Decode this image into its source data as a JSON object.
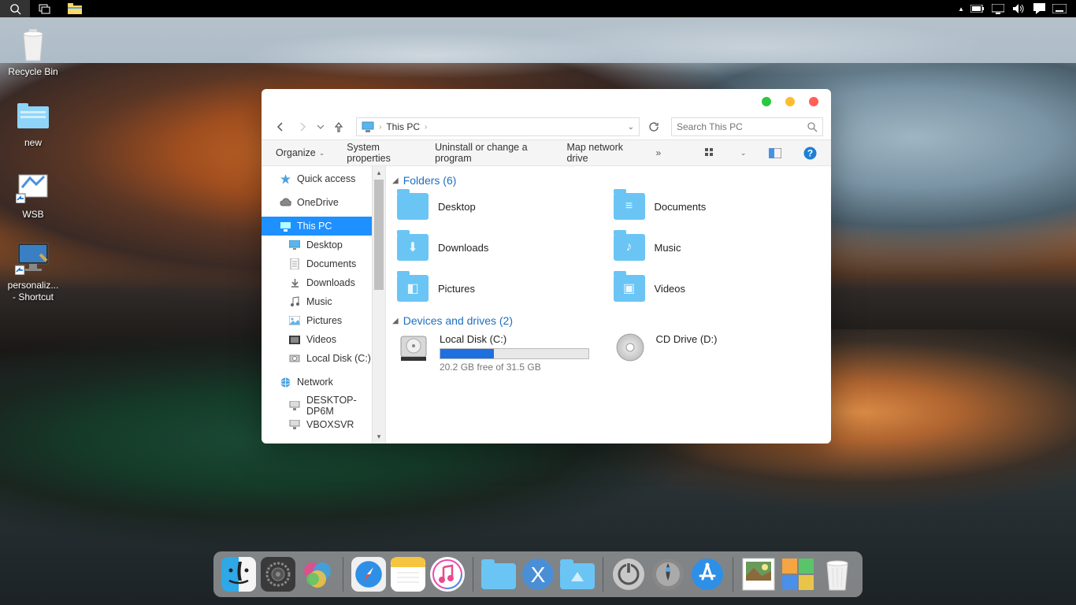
{
  "taskbar": {
    "tray": [
      "battery-icon",
      "display-icon",
      "volume-icon",
      "notifications-icon",
      "keyboard-icon"
    ]
  },
  "desktop": {
    "icons": [
      {
        "name": "recycle-bin",
        "label": "Recycle Bin"
      },
      {
        "name": "new-folder",
        "label": "new"
      },
      {
        "name": "wsb",
        "label": "WSB"
      },
      {
        "name": "personalize-shortcut",
        "label": "personaliz... - Shortcut"
      }
    ]
  },
  "window": {
    "breadcrumb": {
      "location": "This PC"
    },
    "search": {
      "placeholder": "Search This PC"
    },
    "cmdbar": {
      "organize": "Organize",
      "sysprops": "System properties",
      "uninstall": "Uninstall or change a program",
      "mapdrive": "Map network drive"
    },
    "sidebar": {
      "items": [
        {
          "label": "Quick access",
          "icon": "star",
          "child": false
        },
        {
          "label": "OneDrive",
          "icon": "cloud",
          "child": false
        },
        {
          "label": "This PC",
          "icon": "pc",
          "child": false,
          "selected": true
        },
        {
          "label": "Desktop",
          "icon": "desktop",
          "child": true
        },
        {
          "label": "Documents",
          "icon": "doc",
          "child": true
        },
        {
          "label": "Downloads",
          "icon": "down",
          "child": true
        },
        {
          "label": "Music",
          "icon": "music",
          "child": true
        },
        {
          "label": "Pictures",
          "icon": "pic",
          "child": true
        },
        {
          "label": "Videos",
          "icon": "vid",
          "child": true
        },
        {
          "label": "Local Disk (C:)",
          "icon": "disk",
          "child": true
        },
        {
          "label": "Network",
          "icon": "net",
          "child": false
        },
        {
          "label": "DESKTOP-DP6M",
          "icon": "computer",
          "child": true
        },
        {
          "label": "VBOXSVR",
          "icon": "computer",
          "child": true
        }
      ]
    },
    "groups": {
      "folders": {
        "title": "Folders (6)"
      },
      "drives": {
        "title": "Devices and drives (2)"
      }
    },
    "folders": [
      {
        "label": "Desktop",
        "glyph": ""
      },
      {
        "label": "Documents",
        "glyph": "≡"
      },
      {
        "label": "Downloads",
        "glyph": "⬇"
      },
      {
        "label": "Music",
        "glyph": "♪"
      },
      {
        "label": "Pictures",
        "glyph": "◧"
      },
      {
        "label": "Videos",
        "glyph": "▣"
      }
    ],
    "drives": [
      {
        "label": "Local Disk (C:)",
        "free": "20.2 GB free of 31.5 GB",
        "fill": 36,
        "type": "hdd"
      },
      {
        "label": "CD Drive (D:)",
        "free": "",
        "fill": 0,
        "type": "cd"
      }
    ]
  },
  "dock": {
    "items": [
      {
        "name": "finder"
      },
      {
        "name": "settings"
      },
      {
        "name": "gamecenter"
      },
      {
        "sep": true
      },
      {
        "name": "safari"
      },
      {
        "name": "notes"
      },
      {
        "name": "itunes"
      },
      {
        "sep": true
      },
      {
        "name": "folder1"
      },
      {
        "name": "folder2"
      },
      {
        "name": "folder3"
      },
      {
        "sep": true
      },
      {
        "name": "power"
      },
      {
        "name": "launchpad"
      },
      {
        "name": "appstore"
      },
      {
        "sep": true
      },
      {
        "name": "photo"
      },
      {
        "name": "tiles"
      },
      {
        "name": "trash"
      }
    ]
  }
}
